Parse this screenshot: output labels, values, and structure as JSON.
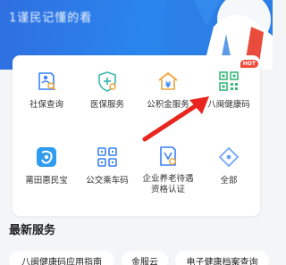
{
  "banner": {
    "title": "1谨民记懂的看"
  },
  "services": [
    {
      "label": "社保查询",
      "icon": "social-security-query-icon"
    },
    {
      "label": "医保服务",
      "icon": "medical-insurance-icon"
    },
    {
      "label": "公积金服务",
      "icon": "housing-fund-icon"
    },
    {
      "label": "八闽健康码",
      "icon": "health-code-icon",
      "badge": "HOT"
    },
    {
      "label": "莆田惠民宝",
      "icon": "putian-huiminbao-icon"
    },
    {
      "label": "公交乘车码",
      "icon": "bus-qr-code-icon"
    },
    {
      "label": "企业养老待遇资格认证",
      "icon": "pension-certification-icon"
    },
    {
      "label": "全部",
      "icon": "all-services-icon"
    }
  ],
  "latest": {
    "title": "最新服务",
    "items": [
      "八闽健康码应用指南",
      "金服云",
      "电子健康档案查询"
    ]
  },
  "colors": {
    "accent": "#3a82f7",
    "banner": "#2a86ee",
    "hot_badge": "#f04c3c",
    "arrow": "#e8261f"
  }
}
